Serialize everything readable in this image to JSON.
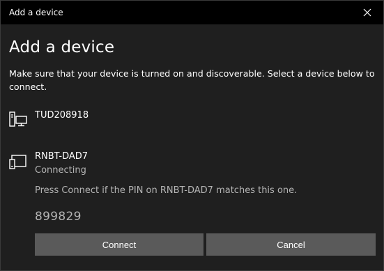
{
  "window": {
    "title": "Add a device",
    "close_icon": "close-icon"
  },
  "content": {
    "title": "Add a device",
    "instructions": "Make sure that your device is turned on and discoverable. Select a device below to connect."
  },
  "devices": [
    {
      "name": "TUD208918",
      "icon": "desktop-computer-icon",
      "status": ""
    },
    {
      "name": "RNBT-DAD7",
      "icon": "tablet-device-icon",
      "status": "Connecting"
    }
  ],
  "pairing": {
    "prompt": "Press Connect if the PIN on RNBT-DAD7 matches this one.",
    "pin": "899829"
  },
  "buttons": {
    "connect_label": "Connect",
    "cancel_label": "Cancel"
  },
  "colors": {
    "titlebar_bg": "#000000",
    "window_bg": "#1f1f1f",
    "button_bg": "#5a5a5a",
    "secondary_text": "#b4b4b4"
  }
}
